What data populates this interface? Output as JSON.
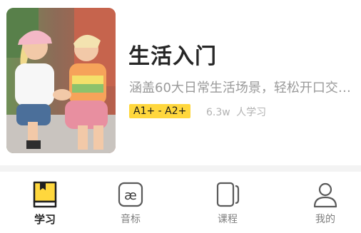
{
  "course": {
    "title": "生活入门",
    "description": "涵盖60大日常生活场景，轻松开口交…",
    "level": "A1+ - A2+",
    "learners_count": "6.3w",
    "learners_suffix": "人学习",
    "thumbnail": "photo-two-smiling-friends"
  },
  "tabbar": {
    "active_color": "#ffd73d",
    "items": [
      {
        "label": "学习",
        "icon": "book-icon",
        "active": true
      },
      {
        "label": "音标",
        "icon": "phonetic-ae-icon",
        "active": false
      },
      {
        "label": "课程",
        "icon": "courses-icon",
        "active": false
      },
      {
        "label": "我的",
        "icon": "profile-icon",
        "active": false
      }
    ]
  }
}
